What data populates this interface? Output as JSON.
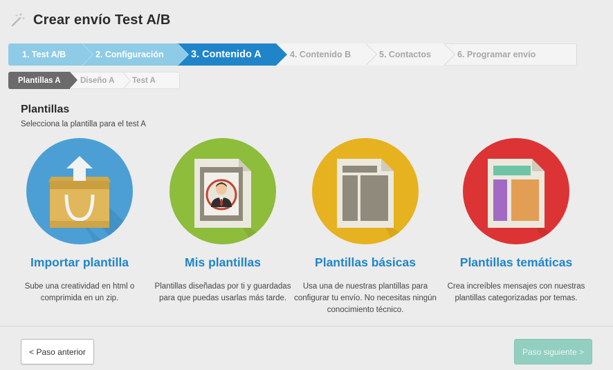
{
  "header": {
    "title": "Crear envío Test A/B",
    "icon": "magic-wand-icon"
  },
  "steps": [
    {
      "label": "1. Test A/B",
      "state": "done"
    },
    {
      "label": "2. Configuración",
      "state": "done"
    },
    {
      "label": "3. Contenido  A",
      "state": "active"
    },
    {
      "label": "4. Contenido  B",
      "state": "todo"
    },
    {
      "label": "5. Contactos",
      "state": "todo"
    },
    {
      "label": "6. Programar envío",
      "state": "todo"
    }
  ],
  "substeps": [
    {
      "label": "Plantillas  A",
      "state": "active"
    },
    {
      "label": "Diseño  A",
      "state": "todo"
    },
    {
      "label": "Test  A",
      "state": "todo"
    }
  ],
  "section": {
    "title": "Plantillas",
    "subtitle": "Selecciona la plantilla para el test A"
  },
  "cards": [
    {
      "title": "Importar plantilla",
      "desc": "Sube una creatividad en html o comprimida en un zip.",
      "color": "#4b9fd5",
      "icon": "import-box-icon"
    },
    {
      "title": "Mis plantillas",
      "desc": "Plantillas diseñadas por ti y guardadas para que puedas usarlas más tarde.",
      "color": "#8ebc3b",
      "icon": "user-template-icon"
    },
    {
      "title": "Plantillas básicas",
      "desc": "Usa una de nuestras plantillas para configurar tu envío. No necesitas ningún conocimiento técnico.",
      "color": "#e7b21f",
      "icon": "basic-template-icon"
    },
    {
      "title": "Plantillas temáticas",
      "desc": "Crea increíbles mensajes con nuestras plantillas categorizadas por temas.",
      "color": "#dc3434",
      "icon": "themed-template-icon"
    }
  ],
  "footer": {
    "prev_label": "< Paso anterior",
    "next_label": "Paso siguiente >"
  }
}
